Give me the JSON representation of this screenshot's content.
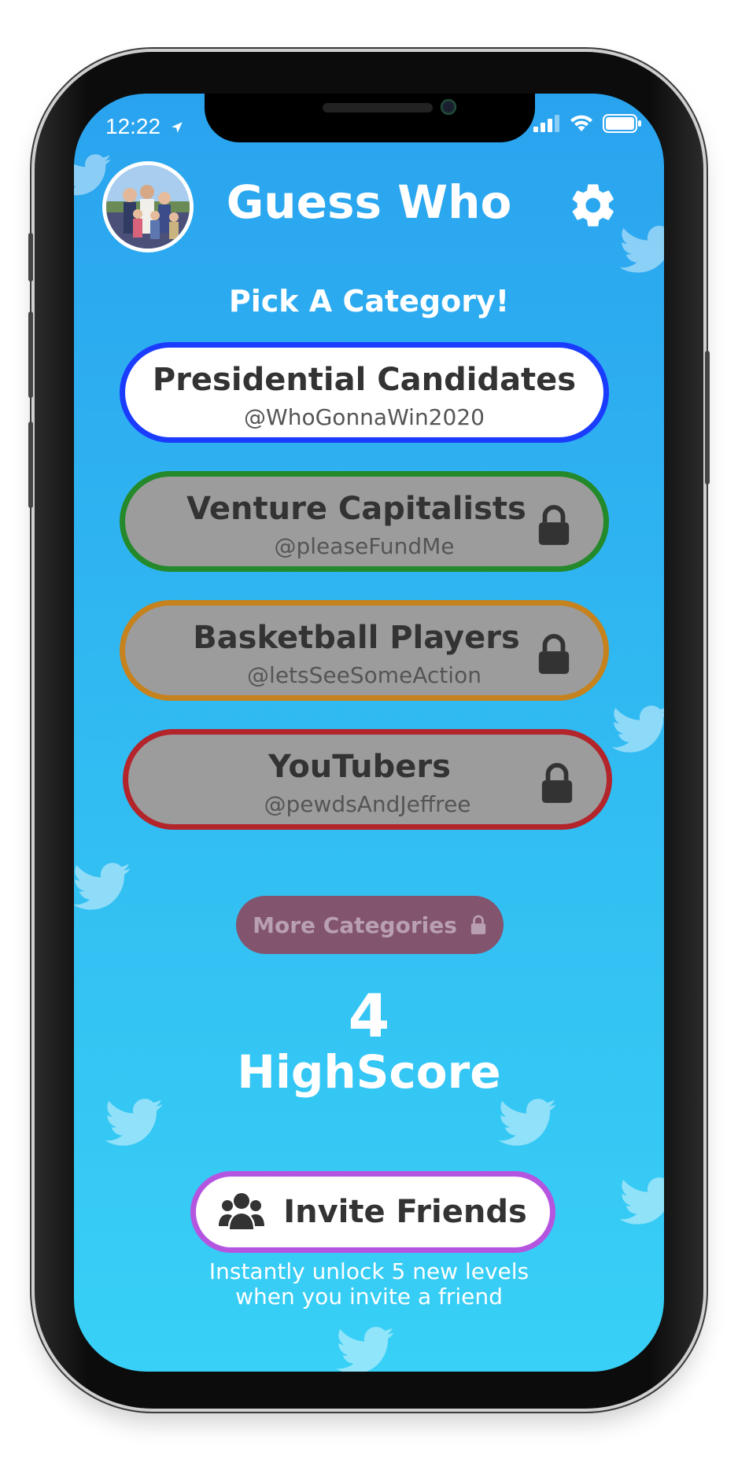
{
  "status_bar": {
    "time": "12:22"
  },
  "header": {
    "title": "Guess Who"
  },
  "main": {
    "subtitle": "Pick A Category!",
    "categories": [
      {
        "name": "Presidential Candidates",
        "handle": "@WhoGonnaWin2020",
        "locked": false,
        "border_color": "#1a3cff"
      },
      {
        "name": "Venture Capitalists",
        "handle": "@pleaseFundMe",
        "locked": true,
        "border_color": "#23892a"
      },
      {
        "name": "Basketball Players",
        "handle": "@letsSeeSomeAction",
        "locked": true,
        "border_color": "#c6821d"
      },
      {
        "name": "YouTubers",
        "handle": "@pewdsAndJeffree",
        "locked": true,
        "border_color": "#b3242b"
      }
    ],
    "more_button": {
      "label": "More Categories",
      "locked": true
    },
    "score": {
      "value": "4",
      "label": "HighScore"
    },
    "invite": {
      "label": "Invite Friends",
      "note_line1": "Instantly unlock 5 new levels",
      "note_line2": "when you invite a friend",
      "border_color": "#b455e0"
    }
  },
  "icons": {
    "avatar": "profile-photo",
    "settings": "gear-icon",
    "lock": "lock-icon",
    "invite": "users-icon",
    "background": "twitter-bird-icon",
    "location": "location-arrow-icon"
  },
  "colors": {
    "background_top": "#2aa3ef",
    "background_bottom": "#38d0f6",
    "locked_fill": "#9c9c9c",
    "more_button_fill": "#82546e"
  }
}
